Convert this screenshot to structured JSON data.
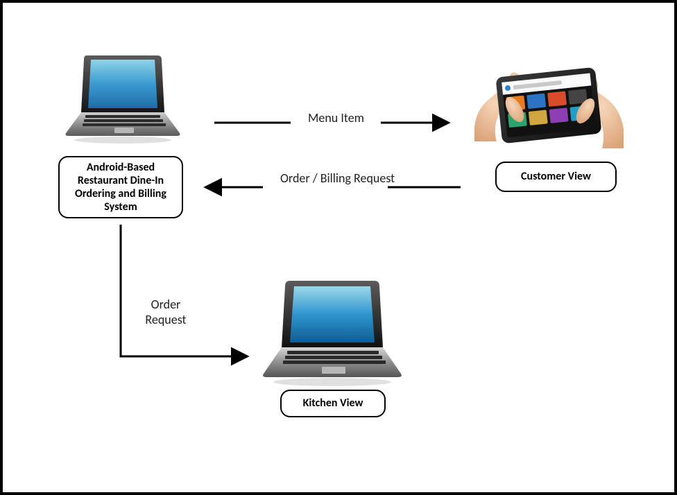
{
  "nodes": {
    "system": {
      "label": "Android-Based Restaurant Dine-In Ordering and Billing System"
    },
    "customer": {
      "label": "Customer View"
    },
    "kitchen": {
      "label": "Kitchen View"
    }
  },
  "edges": {
    "menu_item": {
      "label": "Menu Item"
    },
    "order_billing": {
      "label": "Order / Billing Request"
    },
    "order_request": {
      "label": "Order Request"
    }
  },
  "icons": {
    "system": "laptop-icon",
    "customer": "tablet-in-hands-icon",
    "kitchen": "laptop-icon"
  }
}
